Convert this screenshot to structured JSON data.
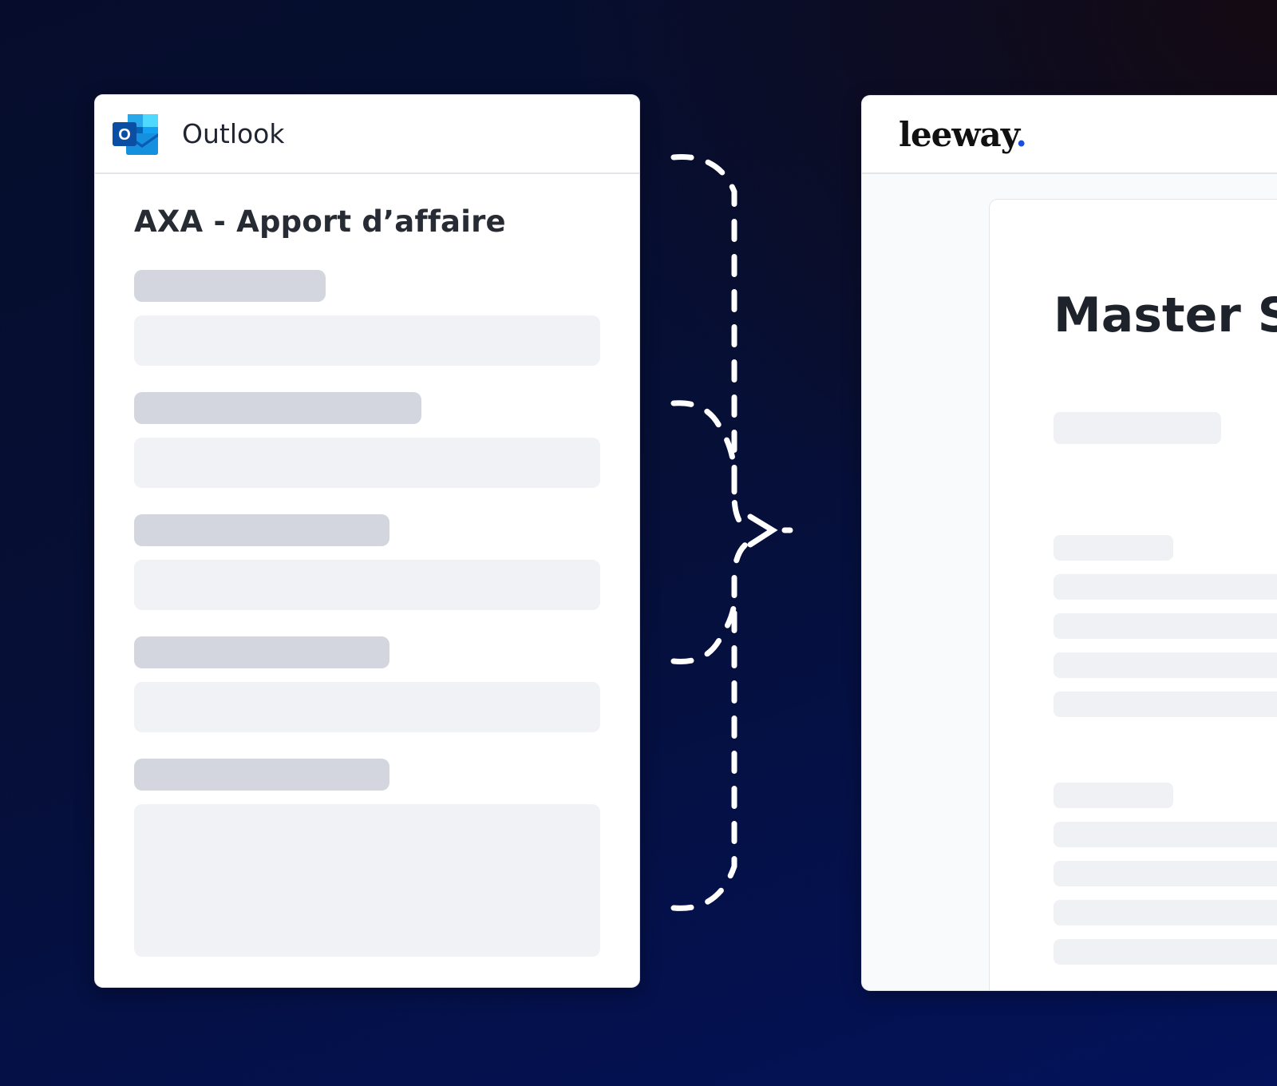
{
  "outlook": {
    "app_name": "Outlook",
    "logo_icon": "outlook-logo-icon",
    "subject": "AXA - Apport d’affaire",
    "fields": [
      {
        "label_width": 240,
        "field_size": "normal"
      },
      {
        "label_width": 360,
        "field_size": "normal"
      },
      {
        "label_width": 320,
        "field_size": "normal"
      },
      {
        "label_width": 320,
        "field_size": "normal"
      },
      {
        "label_width": 320,
        "field_size": "tall"
      }
    ]
  },
  "leeway": {
    "brand": "leeway",
    "brand_dot": ".",
    "document_title": "Master Se"
  },
  "colors": {
    "outlook_blue": "#0a64c8",
    "leeway_accent": "#1d4ed8",
    "skeleton_label": "#d3d6de",
    "skeleton_field": "#f1f2f5"
  }
}
